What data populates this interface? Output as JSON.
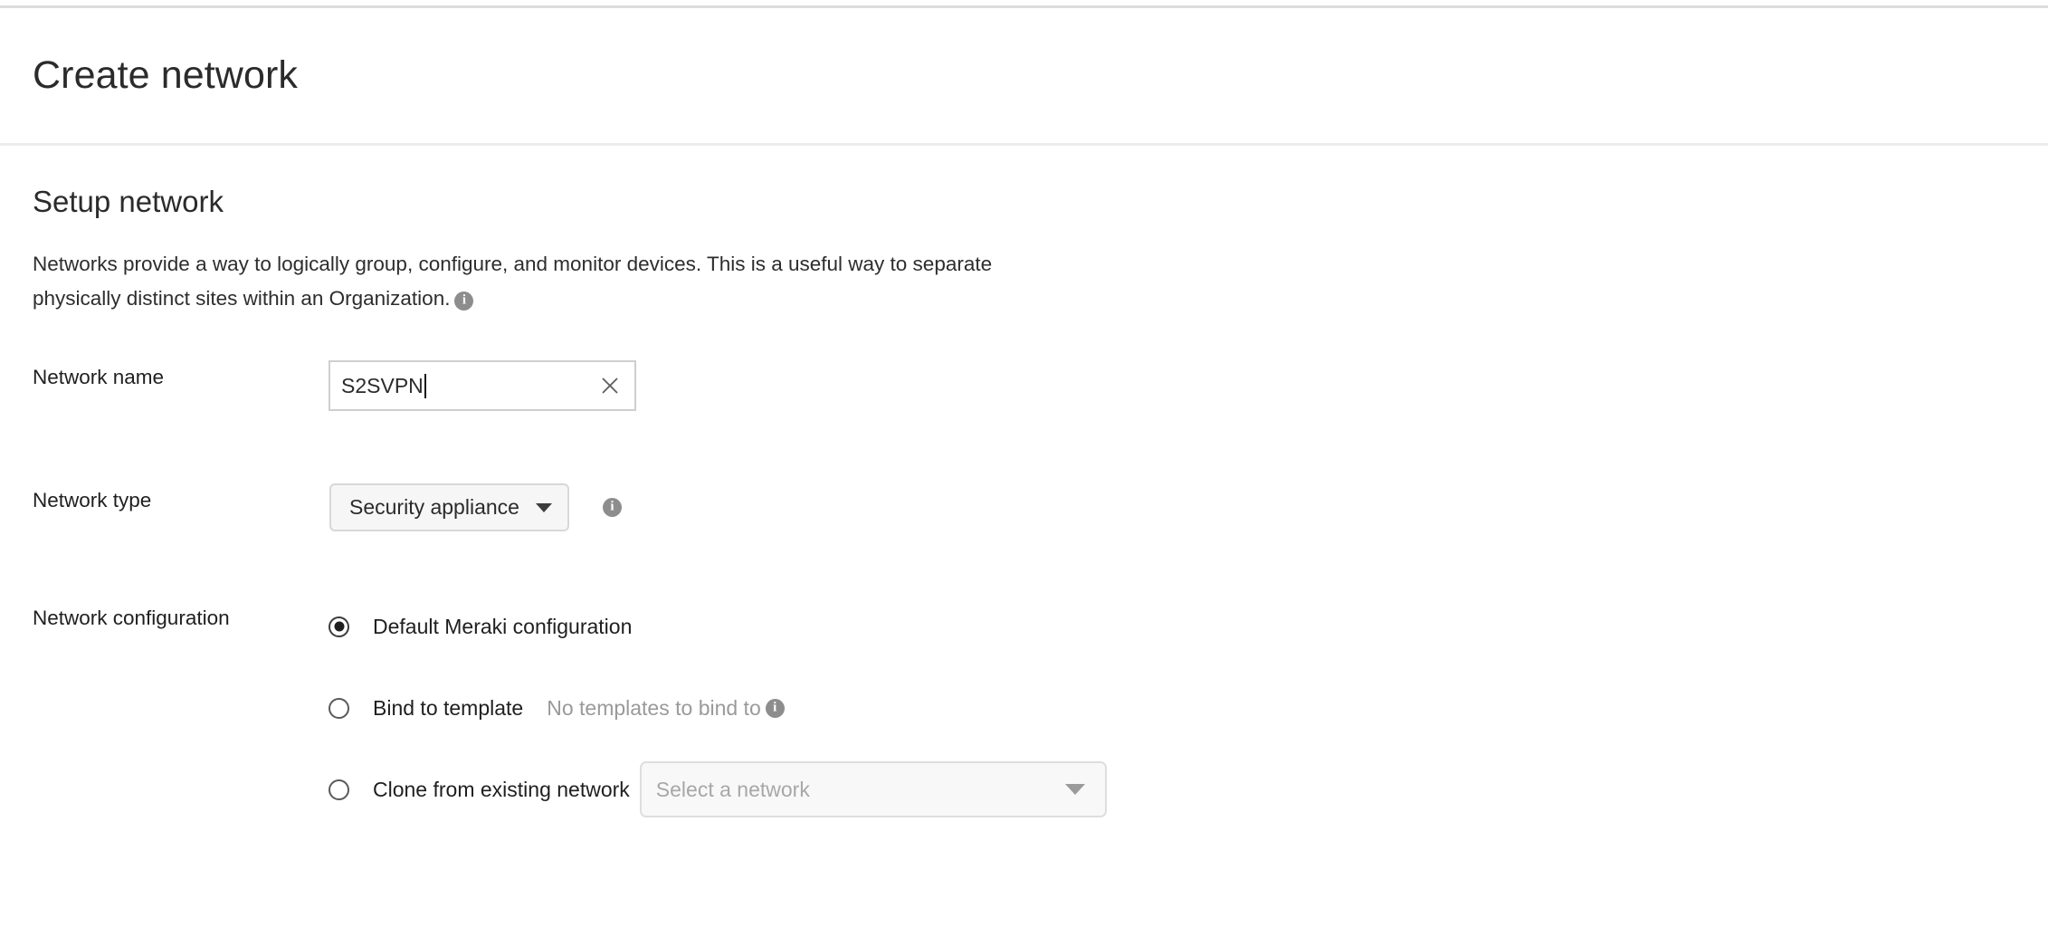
{
  "header": {
    "title": "Create network"
  },
  "setup": {
    "section_title": "Setup network",
    "description_line1": "Networks provide a way to logically group, configure, and monitor devices. This is a useful way to separate",
    "description_line2": "physically distinct sites within an Organization.",
    "info_glyph": "i"
  },
  "network_name": {
    "label": "Network name",
    "value": "S2SVPN",
    "placeholder": "",
    "clear_icon": "close-icon"
  },
  "network_type": {
    "label": "Network type",
    "selected": "Security appliance",
    "info_glyph": "i"
  },
  "network_configuration": {
    "label": "Network configuration",
    "options": [
      {
        "label": "Default Meraki configuration",
        "selected": true,
        "hint": "",
        "has_info": false
      },
      {
        "label": "Bind to template",
        "selected": false,
        "hint": "No templates to bind to",
        "has_info": true,
        "info_glyph": "i"
      },
      {
        "label": "Clone from existing network",
        "selected": false,
        "hint": "",
        "has_info": false,
        "select_placeholder": "Select a network"
      }
    ]
  },
  "colors": {
    "text": "#1f1f1f",
    "muted": "#9a9a9a",
    "border": "#cfcfcf",
    "control_bg": "#f6f6f6",
    "divider": "#ececec"
  }
}
